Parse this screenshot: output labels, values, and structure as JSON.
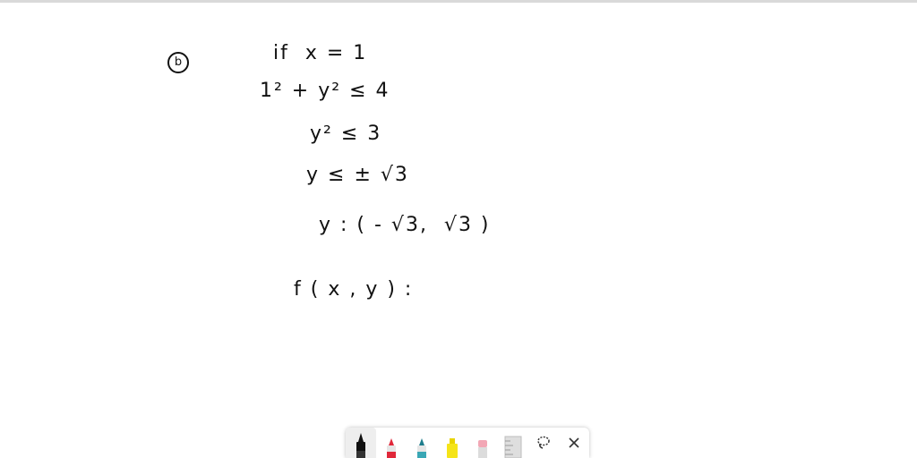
{
  "canvas": {
    "part_label": "b",
    "lines": [
      "if  x = 1",
      "1² + y² ≤ 4",
      "y² ≤ 3",
      "y ≤ ± √3",
      "y : ( - √3,  √3 )",
      "f ( x , y ) :"
    ]
  },
  "toolbar": {
    "tools": [
      {
        "name": "pen-black",
        "color": "#111111"
      },
      {
        "name": "pen-red",
        "color": "#e0283a"
      },
      {
        "name": "pen-teal",
        "color": "#3aa7b5"
      },
      {
        "name": "highlighter-yellow",
        "color": "#f5e418"
      },
      {
        "name": "eraser",
        "color": "#f2a7b5"
      },
      {
        "name": "ruler",
        "color": "#c8c8c8"
      }
    ],
    "lasso_icon": "lasso-icon",
    "close_icon": "close-icon"
  }
}
